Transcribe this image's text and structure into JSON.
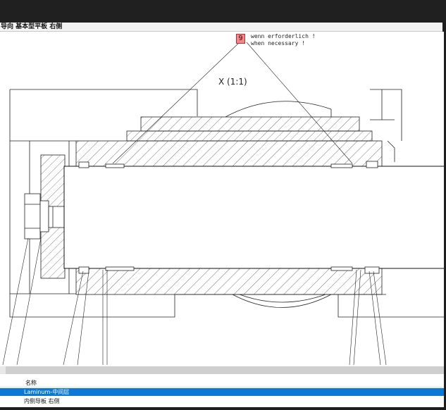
{
  "window": {
    "tab_title": "导向 基本型平板 右侧"
  },
  "drawing": {
    "note_number": "9",
    "note_line_de": "wenn erforderlich !",
    "note_line_en": "when necessary !",
    "view_label": "X (1:1)"
  },
  "panel": {
    "column_header": "名称",
    "rows": [
      {
        "label": "Laminum-中间层",
        "selected": true
      },
      {
        "label": "内侧导板 右侧",
        "selected": false
      }
    ]
  },
  "colors": {
    "selection": "#0a78d4",
    "note_badge": "#f08a8a"
  }
}
